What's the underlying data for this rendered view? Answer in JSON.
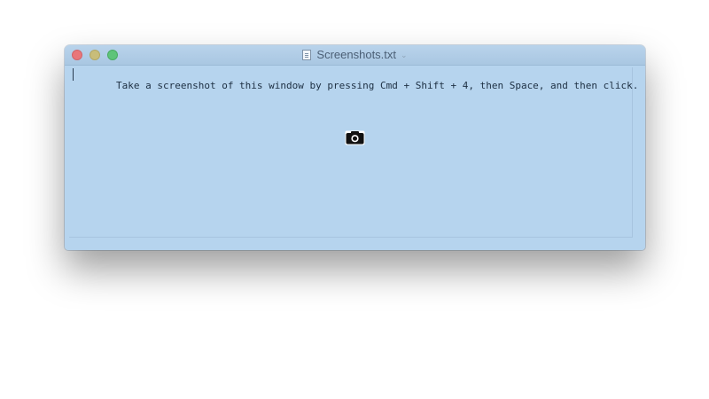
{
  "window": {
    "title": "Screenshots.txt",
    "buttons": {
      "close": "close",
      "minimize": "minimize",
      "zoom": "zoom"
    },
    "title_icon": "document-icon",
    "title_menu_icon": "chevron-down-icon"
  },
  "editor": {
    "content": "Take a screenshot of this window by pressing Cmd + Shift + 4, then Space, and then click."
  },
  "cursor": {
    "icon": "camera-icon"
  },
  "colors": {
    "selection_overlay": "#b6d4ee",
    "close": "#e9767a",
    "minimize": "#c8bd7a",
    "zoom": "#5ec47a"
  }
}
